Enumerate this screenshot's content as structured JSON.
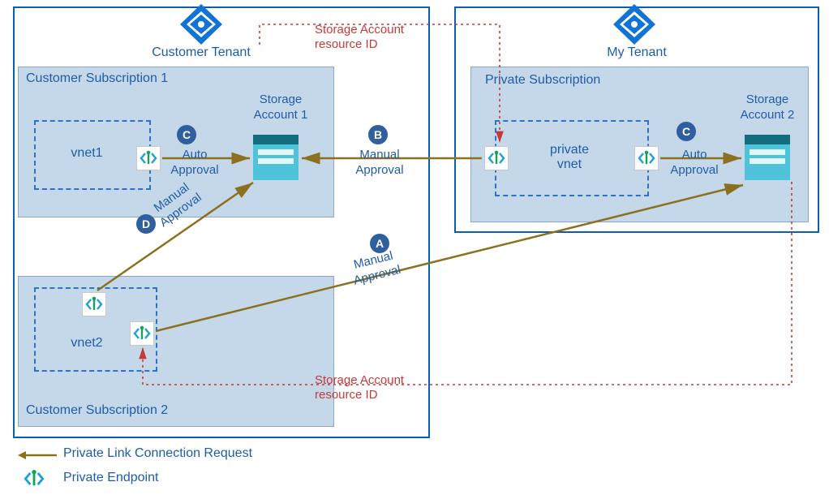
{
  "tenants": {
    "customer": {
      "label": "Customer Tenant"
    },
    "mine": {
      "label": "My Tenant"
    }
  },
  "subscriptions": {
    "cust1": {
      "label": "Customer Subscription 1"
    },
    "cust2": {
      "label": "Customer Subscription 2"
    },
    "priv": {
      "label": "Private Subscription"
    }
  },
  "vnets": {
    "vnet1": {
      "label": "vnet1"
    },
    "vnet2": {
      "label": "vnet2"
    },
    "private": {
      "label_line1": "private",
      "label_line2": "vnet"
    }
  },
  "storage": {
    "sa1": {
      "label_line1": "Storage",
      "label_line2": "Account 1"
    },
    "sa2": {
      "label_line1": "Storage",
      "label_line2": "Account 2"
    }
  },
  "connections": {
    "a": {
      "badge": "A",
      "label_line1": "Manual",
      "label_line2": "Approval"
    },
    "b": {
      "badge": "B",
      "label_line1": "Manual",
      "label_line2": "Approval"
    },
    "c": {
      "badge": "C",
      "label_line1": "Auto",
      "label_line2": "Approval"
    },
    "c2": {
      "badge": "C",
      "label_line1": "Auto",
      "label_line2": "Approval"
    },
    "d": {
      "badge": "D",
      "label_line1": "Manual",
      "label_line2": "Approval"
    }
  },
  "annotations": {
    "resid_top": {
      "line1": "Storage Account",
      "line2": "resource ID"
    },
    "resid_bottom": {
      "line1": "Storage Account",
      "line2": "resource ID"
    }
  },
  "legend": {
    "request": "Private Link Connection Request",
    "endpoint": "Private Endpoint"
  },
  "icons": {
    "aad": "azure-ad-icon",
    "pe": "private-endpoint-icon"
  },
  "colors": {
    "azure_blue": "#0b5fb0",
    "panel_blue": "#c5d8ea",
    "text_blue": "#1f5ca8",
    "olive": "#8a701f",
    "red": "#c43a3a"
  }
}
